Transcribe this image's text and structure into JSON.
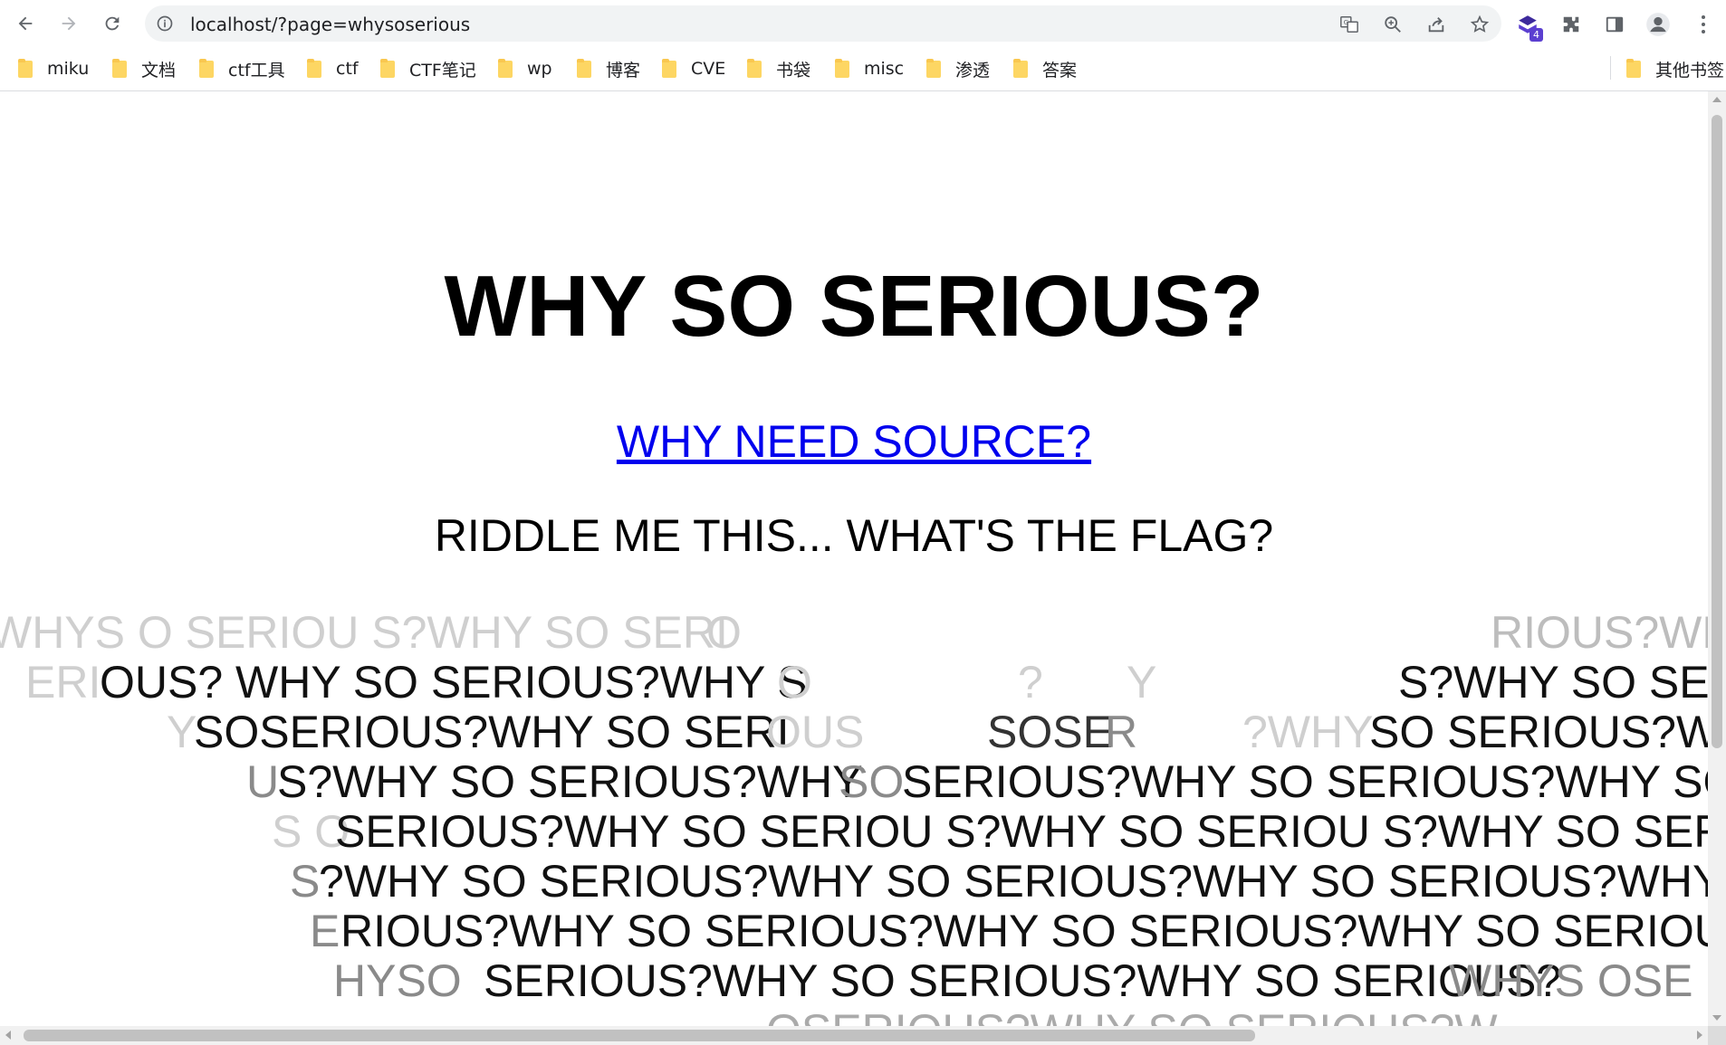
{
  "browser": {
    "url": "localhost/?page=whysoserious",
    "extension_badge": "4",
    "bookmarks": [
      "miku",
      "文档",
      "ctf工具",
      "ctf",
      "CTF笔记",
      "wp",
      "博客",
      "CVE",
      "书袋",
      "misc",
      "渗透",
      "答案"
    ],
    "other_bookmarks": "其他书签"
  },
  "page": {
    "title": "WHY SO SERIOUS?",
    "source_link": "WHY NEED SOURCE?",
    "riddle": "RIDDLE ME THIS... WHAT'S THE FLAG?"
  },
  "wall": {
    "l1a": "WHYS O SERIOU S?WHY SO SERI",
    "l1b": "O",
    "l1c": "RIOUS?WH",
    "l2a": "ERI",
    "l2b": "OUS? WHY SO SERIOUS?WHY S",
    "l2c": "O",
    "l2d": "?",
    "l2e": "Y",
    "l2f": "S?WHY SO SER",
    "l3a": "Y ",
    "l3b": "SOSERIOUS?WHY SO SERI",
    "l3c": "OUS",
    "l3d": "SOSE",
    "l3e": "R",
    "l3f": "?WHY",
    "l3g": "SO SERIOUS?WH",
    "l4a": "U",
    "l4b": "S?WHY SO SERIOUS?WHY",
    "l4c": "SO",
    "l4d": "SERIOUS?WHY SO SERIOUS?WHY SO",
    "l5a": "S O",
    "l5b": "SERIOUS?WHY SO SERIOU S?WHY SO SERIOU S?WHY SO SERIOU",
    "l6a": "S",
    "l6b": "?WHY SO SERIOUS?WHY SO SERIOUS?WHY SO SERIOUS?WHY SO",
    "l7a": "E",
    "l7b": "RIOUS?WHY SO SERIOUS?WHY SO SERIOUS?WHY SO SERIOUS?",
    "l8a": "HYSO",
    "l8b": "SERIOUS?WHY SO SERIOUS?WHY SO SERIOUS?",
    "l8c": "WHYS OSE",
    "l9": "OSERIOUS?WHY SO SERIOUS?W"
  },
  "colors": {
    "link": "#0000ee",
    "text": "#000000",
    "faded_text": "#cfcfcf",
    "mid_text": "#8a8a8a"
  }
}
